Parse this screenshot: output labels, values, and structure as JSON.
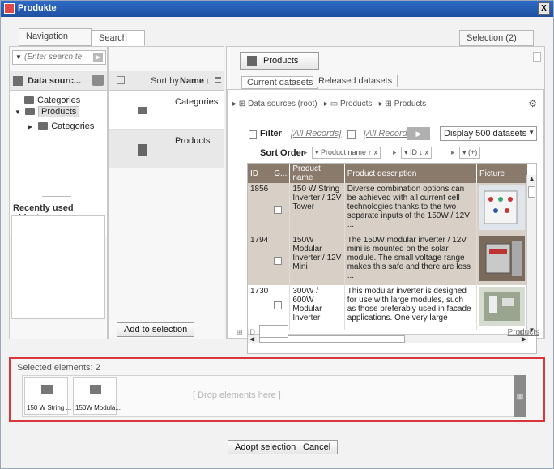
{
  "window": {
    "title": "Produkte",
    "close_label": "X"
  },
  "tabs": {
    "navigation": "Navigation",
    "search": "Search",
    "selection": "Selection (2)"
  },
  "left": {
    "search_placeholder": "(Enter search te",
    "datasources_label": "Data sourc...",
    "tree": {
      "categories": "Categories",
      "products": "Products",
      "child_categories": "Categories"
    },
    "recent_title": "Recently used objects"
  },
  "middle": {
    "sort_label": "Sort by:",
    "sort_value": "Name",
    "sort_arrow": "↓",
    "items": [
      {
        "label": "Categories"
      },
      {
        "label": "Products"
      }
    ],
    "add_button": "Add to selection"
  },
  "right": {
    "products_button": "Products",
    "subtabs": {
      "current": "Current datasets",
      "released": "Released datasets"
    },
    "breadcrumb": [
      "Data sources (root)",
      "Products",
      "Products"
    ],
    "filter": {
      "label": "Filter",
      "all_records_1": "[All Records]",
      "all_records_2": "[All Records]P",
      "display": "Display 500 datasets"
    },
    "sort": {
      "label": "Sort Order",
      "chip1": "▾ Product name  ↑ x",
      "chip2": "▾ ID  ↓ x",
      "chip3": "▾ (+)"
    },
    "table": {
      "headers": [
        "ID",
        "G...",
        "Product name",
        "Product description",
        "Picture"
      ],
      "rows": [
        {
          "id": "1856",
          "name": "150 W String Inverter / 12V Tower",
          "desc": "Diverse combination options can be achieved with all current cell technologies thanks to the two separate inputs of the 150W / 12V ..."
        },
        {
          "id": "1794",
          "name": "150W Modular Inverter / 12V Mini",
          "desc": "The 150W modular inverter / 12V mini is mounted on the solar module. The small voltage range makes this safe and there are less ..."
        },
        {
          "id": "1730",
          "name": "300W / 600W Modular Inverter",
          "desc": "This modular inverter is designed for use with large modules, such as those preferably used in facade applications. One very large"
        }
      ]
    },
    "footer": {
      "id_label": "ID",
      "products_link": "Products"
    }
  },
  "selected": {
    "title": "Selected elements: 2",
    "items": [
      {
        "label": "150 W String ..."
      },
      {
        "label": "150W Modula..."
      }
    ],
    "drop_hint": "[ Drop elements here ]"
  },
  "actions": {
    "adopt": "Adopt selection",
    "cancel": "Cancel"
  },
  "colors": {
    "highlight_border": "#d9363e",
    "title_bar": "#2e6bc7",
    "table_header": "#8a7a6c"
  }
}
